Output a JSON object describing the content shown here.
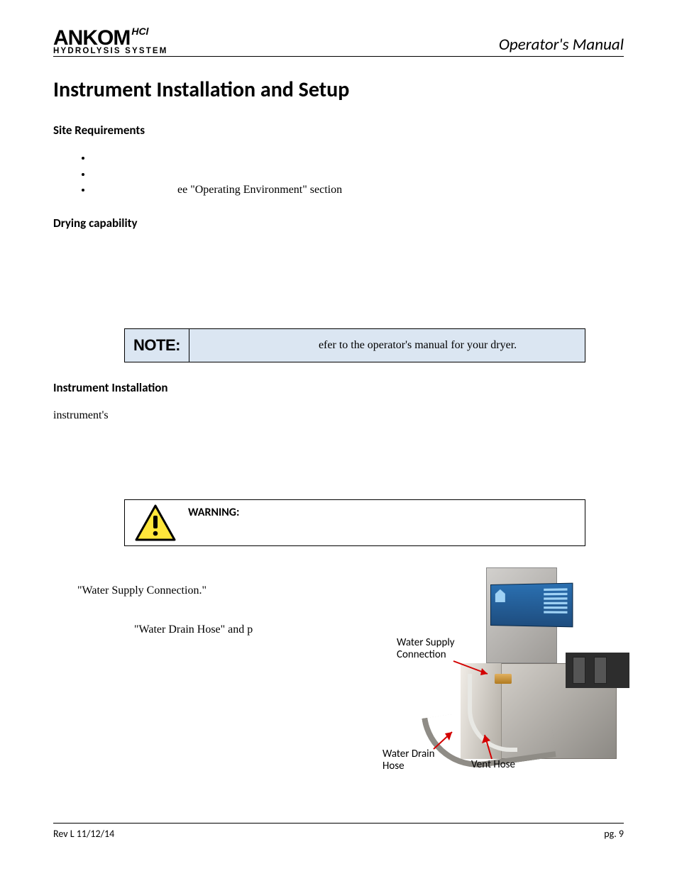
{
  "header": {
    "logo_main": "ANKOM",
    "logo_sup": "HCl",
    "logo_sub": "HYDROLYSIS SYSTEM",
    "doc_title": "Operator's Manual"
  },
  "title": "Instrument Installation and Setup",
  "site_req": {
    "heading": "Site Requirements",
    "items": [
      "",
      "",
      "ee \"Operating Environment\" section"
    ]
  },
  "drying": {
    "heading": "Drying capability",
    "para": ""
  },
  "note": {
    "label": "NOTE:",
    "text": "efer to the operator's manual for your dryer."
  },
  "install": {
    "heading": "Instrument Installation",
    "intro": "instrument's"
  },
  "warning": {
    "label": "WARNING:",
    "text": ""
  },
  "steps": [
    "\"Water Supply Connection.\"",
    "\"Water Drain Hose\" and p",
    ""
  ],
  "fig": {
    "supply": "Water Supply\nConnection",
    "drain": "Water Drain\nHose",
    "vent": "Vent Hose"
  },
  "footer": {
    "left": "Rev L 11/12/14",
    "right": "pg. 9"
  }
}
